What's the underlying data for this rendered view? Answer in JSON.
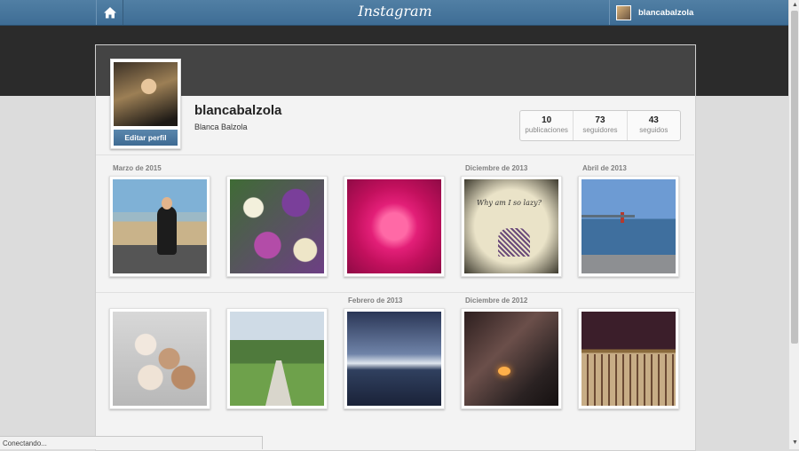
{
  "header": {
    "logo": "Instagram",
    "username": "blancabalzola"
  },
  "profile": {
    "username": "blancabalzola",
    "full_name": "Blanca Balzola",
    "edit_button": "Editar perfil",
    "stats": [
      {
        "count": "10",
        "label": "publicaciones"
      },
      {
        "count": "73",
        "label": "seguidores"
      },
      {
        "count": "43",
        "label": "seguidos"
      }
    ]
  },
  "grid": {
    "row1_dates": [
      "Marzo de 2015",
      "Diciembre de 2013",
      "Abril de 2013"
    ],
    "row2_dates": [
      "Febrero de 2013",
      "Diciembre de 2012"
    ],
    "photos": [
      {
        "subject": "woman-on-beach"
      },
      {
        "subject": "flowers-bouquet"
      },
      {
        "subject": "pink-peony"
      },
      {
        "subject": "why-am-i-so-lazy-drawing",
        "caption_text": "Why am I so lazy?"
      },
      {
        "subject": "sea-lighthouse"
      },
      {
        "subject": "bunnies"
      },
      {
        "subject": "garden-path"
      },
      {
        "subject": "sunset-sea"
      },
      {
        "subject": "fireplace-room"
      },
      {
        "subject": "handbag"
      }
    ]
  },
  "status_bar": "Conectando..."
}
